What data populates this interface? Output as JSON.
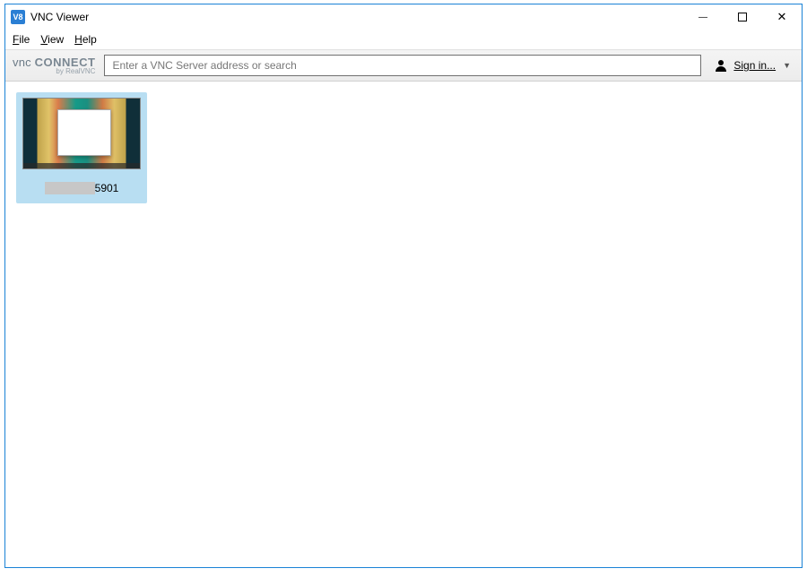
{
  "window": {
    "title": "VNC Viewer",
    "app_icon_text": "V8"
  },
  "menu": {
    "file": "File",
    "view": "View",
    "help": "Help"
  },
  "brand": {
    "line1_vnc": "vnc ",
    "line1_connect": "CONNECT",
    "line2": "by RealVNC"
  },
  "toolbar": {
    "address_placeholder": "Enter a VNC Server address or search",
    "signin_label": "Sign in..."
  },
  "connections": [
    {
      "port_label": "5901"
    }
  ],
  "win_controls": {
    "minimize": "—",
    "maximize": "◻",
    "close": "✕"
  }
}
